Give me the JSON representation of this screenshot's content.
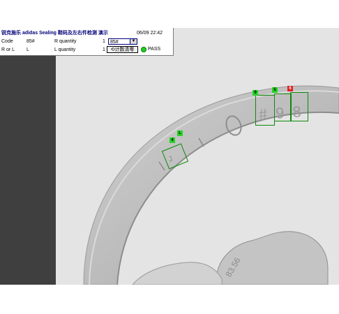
{
  "header": {
    "title": "锐克施乐 adidas Sealing 鞋码及左右件检测 演示",
    "timestamp": "06/09 22:42",
    "code_label": "Code",
    "code_value": "85#",
    "side_label": "R or L",
    "side_value": "L",
    "r_quantity_label": "R quantity",
    "r_quantity_value": "1",
    "l_quantity_label": "L quantity",
    "l_quantity_value": "1",
    "code_select_value": "85#",
    "clear_button_label": "计数清零",
    "status_text": "PASS",
    "status_color": "#22cc22"
  },
  "roi_markers": [
    {
      "id": "L",
      "color": "green"
    },
    {
      "id": "4",
      "color": "green"
    },
    {
      "id": "9",
      "color": "green"
    },
    {
      "id": "5",
      "color": "green"
    },
    {
      "id": "6",
      "color": "red"
    }
  ],
  "colors": {
    "background": "#ffffff",
    "camera_background": "#e2e2e2",
    "left_strip": "#3f3f3f",
    "header_title": "#00007a",
    "roi_green": "#25d425",
    "roi_red": "#e32020"
  }
}
